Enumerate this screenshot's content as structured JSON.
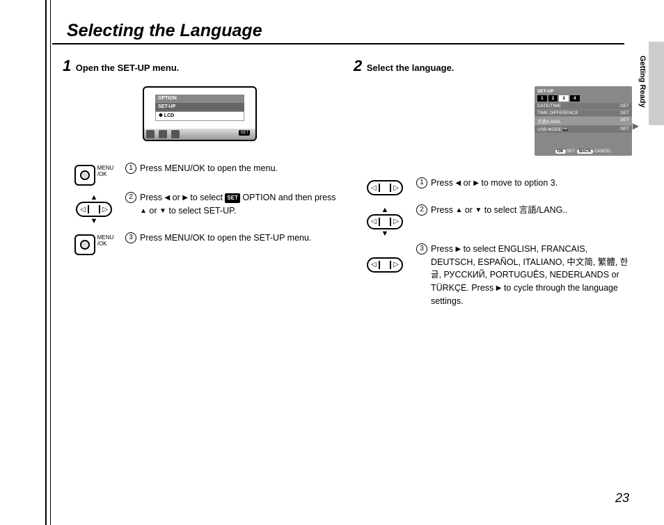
{
  "title": "Selecting the Language",
  "side_tab": "Getting Ready",
  "page_number": "23",
  "left": {
    "num": "1",
    "heading": "Open the SET-UP menu.",
    "screen": {
      "row1": "OPTION",
      "row2": "SET-UP",
      "row3": "✽ LCD",
      "set": "SET"
    },
    "menu_ok": "MENU\n/OK",
    "subs": [
      {
        "n": "1",
        "text": "Press MENU/OK to open the menu."
      },
      {
        "n": "2",
        "text_pre": "Press ",
        "mid": " or ",
        "after_arrows": " to select ",
        "badge": "SET",
        "after_badge": " OPTION and then press ",
        "mid2": " or ",
        "tail": " to select SET-UP."
      },
      {
        "n": "3",
        "text": "Press MENU/OK to open the SET-UP menu."
      }
    ]
  },
  "right": {
    "num": "2",
    "heading": "Select the language.",
    "screen": {
      "head": "SET-UP",
      "tabs": [
        "1",
        "2",
        "3",
        "4"
      ],
      "active_tab": 2,
      "rows": [
        {
          "l": "DATE/TIME",
          "r": ":SET"
        },
        {
          "l": "TIME DIFFERENCE",
          "r": ":SET"
        },
        {
          "l": "言語/LANG.",
          "r": ":SET"
        },
        {
          "l": "USB MODE 📷",
          "r": ":SET"
        }
      ],
      "foot_ok": "OK",
      "foot_set": "SET",
      "foot_back": "BACK",
      "foot_cancel": "CANCEL"
    },
    "subs": [
      {
        "n": "1",
        "text_pre": "Press ",
        "mid": " or ",
        "tail": " to move to option 3."
      },
      {
        "n": "2",
        "text_pre": "Press ",
        "mid": " or ",
        "tail": " to select 言語/LANG.."
      },
      {
        "n": "3",
        "text_pre": "Press ",
        "after": " to select ENGLISH, FRANCAIS, DEUTSCH, ESPAÑOL, ITALIANO, 中文简, 繁體, 한글, РУССКИЙ, PORTUGUÊS, NEDERLANDS or TÜRKÇE. Press ",
        "tail2": " to cycle through the language settings."
      }
    ]
  }
}
